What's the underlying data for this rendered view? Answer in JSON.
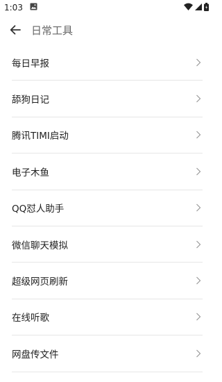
{
  "status_bar": {
    "time": "1:03"
  },
  "header": {
    "title": "日常工具"
  },
  "items": [
    {
      "label": "每日早报"
    },
    {
      "label": "舔狗日记"
    },
    {
      "label": "腾讯TIMI启动"
    },
    {
      "label": "电子木鱼"
    },
    {
      "label": "QQ怼人助手"
    },
    {
      "label": "微信聊天模拟"
    },
    {
      "label": "超级网页刷新"
    },
    {
      "label": "在线听歌"
    },
    {
      "label": "网盘传文件"
    }
  ],
  "colors": {
    "divider": "#e6e6e6",
    "title": "#666666",
    "text": "#222222",
    "chevron": "#9a9a9a"
  }
}
